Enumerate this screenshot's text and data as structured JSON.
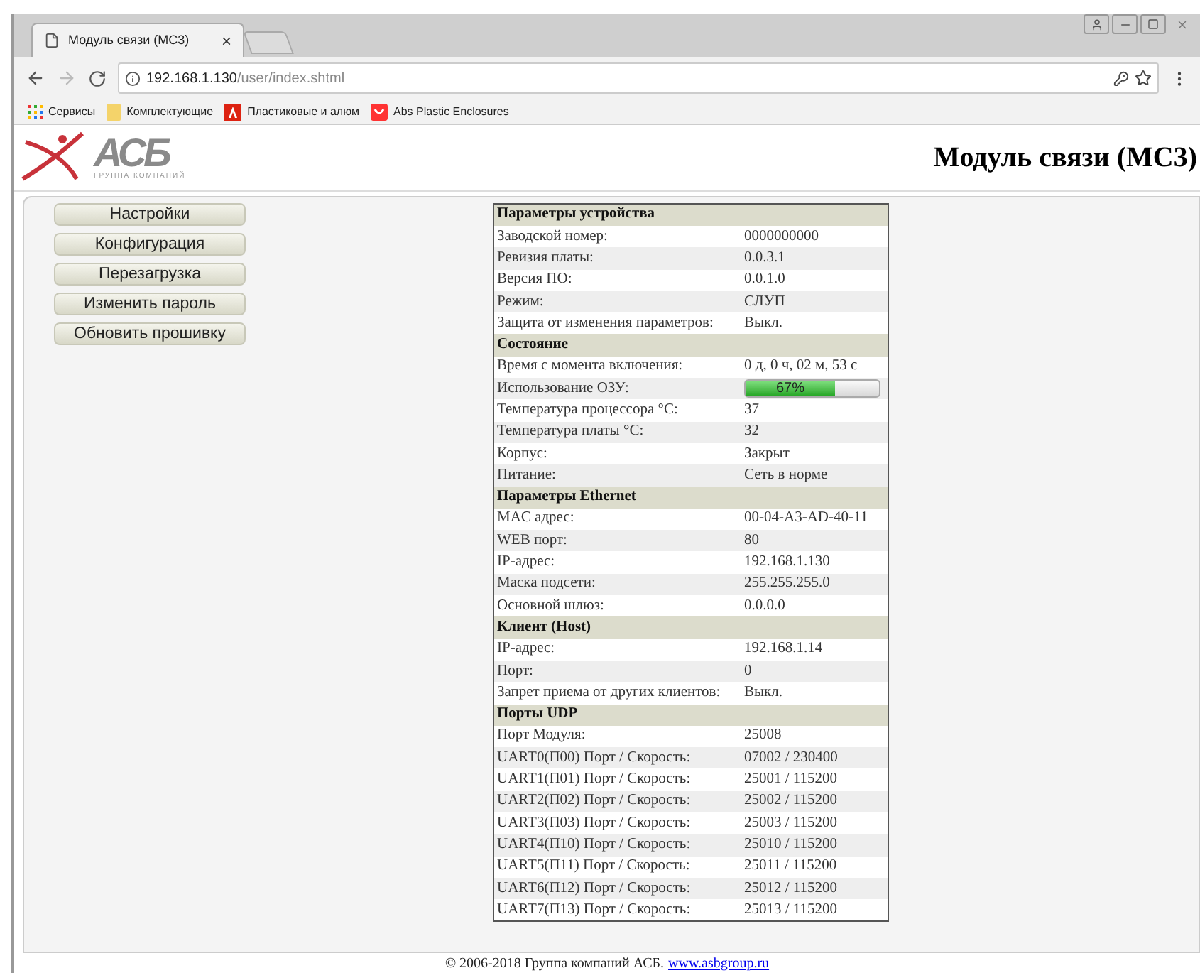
{
  "browser": {
    "tab": {
      "title": "Модуль связи (МС3)",
      "close": "×"
    },
    "address": {
      "host": "192.168.1.130",
      "path": "/user/index.shtml"
    },
    "bookmarks": [
      {
        "kind": "apps",
        "label": "Сервисы"
      },
      {
        "kind": "folder",
        "label": "Комплектующие"
      },
      {
        "kind": "adobe",
        "label": "Пластиковые и алюм"
      },
      {
        "kind": "shop",
        "label": "Abs Plastic Enclosures"
      }
    ]
  },
  "header": {
    "logo": {
      "mark": "АСБ",
      "subtitle": "ГРУППА КОМПАНИЙ"
    },
    "title": "Модуль связи (МС3)"
  },
  "menu": [
    "Настройки",
    "Конфигурация",
    "Перезагрузка",
    "Изменить пароль",
    "Обновить прошивку"
  ],
  "sections": [
    {
      "title": "Параметры устройства",
      "rows": [
        {
          "label": "Заводской номер:",
          "value": "0000000000"
        },
        {
          "label": "Ревизия платы:",
          "value": "0.0.3.1"
        },
        {
          "label": "Версия ПО:",
          "value": "0.0.1.0"
        },
        {
          "label": "Режим:",
          "value": "СЛУП"
        },
        {
          "label": "Защита от изменения параметров:",
          "value": "Выкл."
        }
      ]
    },
    {
      "title": "Состояние",
      "rows": [
        {
          "label": "Время с момента включения:",
          "value": "0 д, 0 ч, 02 м, 53 с"
        },
        {
          "label": "Использование ОЗУ:",
          "kind": "progress",
          "level": 0.67,
          "value": "67%"
        },
        {
          "label": "Температура процессора °C:",
          "value": "37"
        },
        {
          "label": "Температура платы °C:",
          "value": "32"
        },
        {
          "label": "Корпус:",
          "value": "Закрыт"
        },
        {
          "label": "Питание:",
          "value": "Сеть в норме"
        }
      ]
    },
    {
      "title": "Параметры Ethernet",
      "rows": [
        {
          "label": "MAC адрес:",
          "value": "00-04-A3-AD-40-11"
        },
        {
          "label": "WEB порт:",
          "value": "80"
        },
        {
          "label": "IP-адрес:",
          "value": "192.168.1.130"
        },
        {
          "label": "Маска подсети:",
          "value": "255.255.255.0"
        },
        {
          "label": "Основной шлюз:",
          "value": "0.0.0.0"
        }
      ]
    },
    {
      "title": "Клиент (Host)",
      "rows": [
        {
          "label": "IP-адрес:",
          "value": "192.168.1.14"
        },
        {
          "label": "Порт:",
          "value": "0"
        },
        {
          "label": "Запрет приема от других клиентов:",
          "value": "Выкл."
        }
      ]
    },
    {
      "title": "Порты UDP",
      "rows": [
        {
          "label": "Порт Модуля:",
          "value": "25008"
        },
        {
          "label": "UART0(П00) Порт / Скорость:",
          "value": "07002 / 230400"
        },
        {
          "label": "UART1(П01) Порт / Скорость:",
          "value": "25001 / 115200"
        },
        {
          "label": "UART2(П02) Порт / Скорость:",
          "value": "25002 / 115200"
        },
        {
          "label": "UART3(П03) Порт / Скорость:",
          "value": "25003 / 115200"
        },
        {
          "label": "UART4(П10) Порт / Скорость:",
          "value": "25010 / 115200"
        },
        {
          "label": "UART5(П11) Порт / Скорость:",
          "value": "25011 / 115200"
        },
        {
          "label": "UART6(П12) Порт / Скорость:",
          "value": "25012 / 115200"
        },
        {
          "label": "UART7(П13) Порт / Скорость:",
          "value": "25013 / 115200"
        }
      ]
    }
  ],
  "footer": {
    "text": "© 2006-2018 Группа компаний АСБ.",
    "link": "www.asbgroup.ru"
  }
}
